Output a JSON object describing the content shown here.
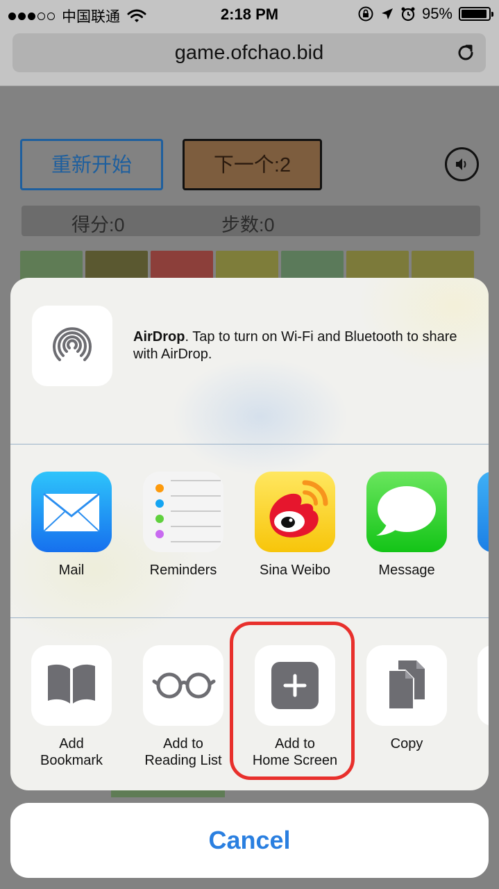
{
  "status_bar": {
    "signal_dots_filled": 3,
    "signal_dots_total": 5,
    "carrier": "中国联通",
    "time": "2:18 PM",
    "battery_percent": "95%",
    "battery_level": 0.95
  },
  "browser": {
    "url": "game.ofchao.bid",
    "reload_icon": "reload-icon"
  },
  "game": {
    "restart_label": "重新开始",
    "next_label": "下一个:2",
    "score_label": "得分:0",
    "steps_label": "步数:0",
    "tile_colors": [
      "#5f7c55",
      "#5a5830",
      "#8c3f3a",
      "#7e7d3a",
      "#5b7a5a",
      "#7c7a3a",
      "#7c7a3a"
    ]
  },
  "share_sheet": {
    "airdrop": {
      "title": "AirDrop",
      "message": ". Tap to turn on Wi-Fi and Bluetooth to share with AirDrop."
    },
    "apps": [
      {
        "label": "Mail",
        "icon": "mail-icon"
      },
      {
        "label": "Reminders",
        "icon": "reminders-icon"
      },
      {
        "label": "Sina Weibo",
        "icon": "weibo-icon"
      },
      {
        "label": "Message",
        "icon": "message-icon"
      }
    ],
    "actions": [
      {
        "line1": "Add",
        "line2": "Bookmark",
        "icon": "bookmark-icon"
      },
      {
        "line1": "Add to",
        "line2": "Reading List",
        "icon": "glasses-icon"
      },
      {
        "line1": "Add to",
        "line2": "Home Screen",
        "icon": "plus-icon"
      },
      {
        "line1": "Copy",
        "line2": "",
        "icon": "copy-icon"
      }
    ],
    "cancel_label": "Cancel"
  },
  "colors": {
    "highlight": "#e8302c",
    "cancel_text": "#2a7fe0",
    "restart_border": "#1e5f9e"
  }
}
